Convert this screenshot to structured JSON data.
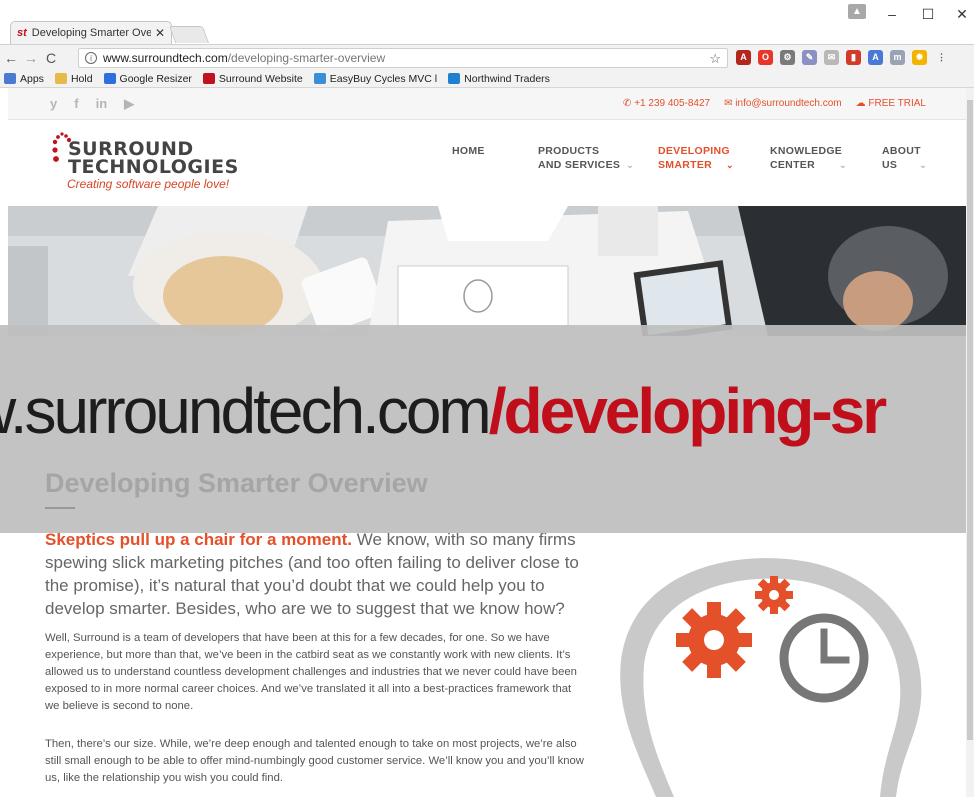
{
  "browser": {
    "tab_title": "Developing Smarter Ove",
    "tab_favicon": "st",
    "url_host": "www.surroundtech.com",
    "url_path": "/developing-smarter-overview",
    "window_controls": {
      "minimize": "–",
      "maximize": "☐",
      "close": "✕"
    },
    "bookmarks": [
      {
        "label": "Apps",
        "icon": "apps-grid-icon",
        "color": "#4a7bd0"
      },
      {
        "label": "Hold",
        "icon": "folder-icon",
        "color": "#e6b94b"
      },
      {
        "label": "Google Resizer",
        "icon": "resizer-icon",
        "color": "#2f6fdd"
      },
      {
        "label": "Surround Website",
        "icon": "surround-icon",
        "color": "#c1121f"
      },
      {
        "label": "EasyBuy Cycles MVC l",
        "icon": "globe-icon",
        "color": "#3c8dd8"
      },
      {
        "label": "Northwind Traders",
        "icon": "window-icon",
        "color": "#1f7fd1"
      }
    ],
    "extensions": [
      {
        "name": "bookmark-star-icon",
        "glyph": "☆",
        "color": "transparent"
      },
      {
        "name": "pdf-icon",
        "glyph": "A",
        "color": "#b3261e"
      },
      {
        "name": "opera-icon",
        "glyph": "O",
        "color": "#e8362b"
      },
      {
        "name": "dev-tools-icon",
        "glyph": "⚙",
        "color": "#7a7a7a"
      },
      {
        "name": "eyedropper-icon",
        "glyph": "✎",
        "color": "#8a8fc4"
      },
      {
        "name": "mail-icon",
        "glyph": "✉",
        "color": "#b8b8b8"
      },
      {
        "name": "bookmark-red-icon",
        "glyph": "▮",
        "color": "#d23b2a"
      },
      {
        "name": "translate-icon",
        "glyph": "A",
        "color": "#4a78d6"
      },
      {
        "name": "md-icon",
        "glyph": "m",
        "color": "#9aa3b4"
      },
      {
        "name": "bulb-icon",
        "glyph": "✹",
        "color": "#f2b400"
      },
      {
        "name": "menu-icon",
        "glyph": "⋮",
        "color": "transparent"
      }
    ]
  },
  "site": {
    "social": [
      "y",
      "f",
      "in",
      "▶"
    ],
    "phone": "+1 239 405-8427",
    "email": "info@surroundtech.com",
    "trial": "FREE TRIAL",
    "logo": {
      "line1": "SURROUND",
      "line2": "TECHNOLOGIES",
      "tagline": "Creating software people love!"
    },
    "nav": [
      {
        "line1": "HOME",
        "line2": "",
        "active": false
      },
      {
        "line1": "PRODUCTS",
        "line2": "AND SERVICES",
        "active": false
      },
      {
        "line1": "DEVELOPING",
        "line2": "SMARTER",
        "active": true
      },
      {
        "line1": "KNOWLEDGE",
        "line2": "CENTER",
        "active": false
      },
      {
        "line1": "ABOUT",
        "line2": "US",
        "active": false
      }
    ],
    "overlay_url_prefix": "w.surroundtech.com",
    "overlay_url_path": "/developing-sr",
    "page_title": "Developing Smarter Overview",
    "lead_highlight": "Skeptics pull up a chair for a moment.",
    "lead_text": " We know, with so many firms spewing slick marketing pitches (and too often failing to deliver close to the promise), it’s natural that you’d doubt that we could help you to develop smarter. Besides, who are we to suggest that we know how?",
    "paragraph1": "Well, Surround is a team of developers that have been at this for a few decades, for one. So we have experience, but more than that, we’ve been in the catbird seat as we constantly work with new clients. It’s allowed us to understand countless development challenges and industries that we never could have been exposed to in more normal career choices. And we’ve translated it all into a best-practices framework that we believe is second to none.",
    "paragraph2": "Then, there’s our size. While, we’re deep enough and talented enough to take on most projects, we’re also still small enough to be able to offer mind-numbingly good customer service. We’ll know you and you’ll know us, like the relationship you wish you could find."
  },
  "colors": {
    "accent": "#e3502a",
    "overlay_red": "#c00e1b"
  }
}
